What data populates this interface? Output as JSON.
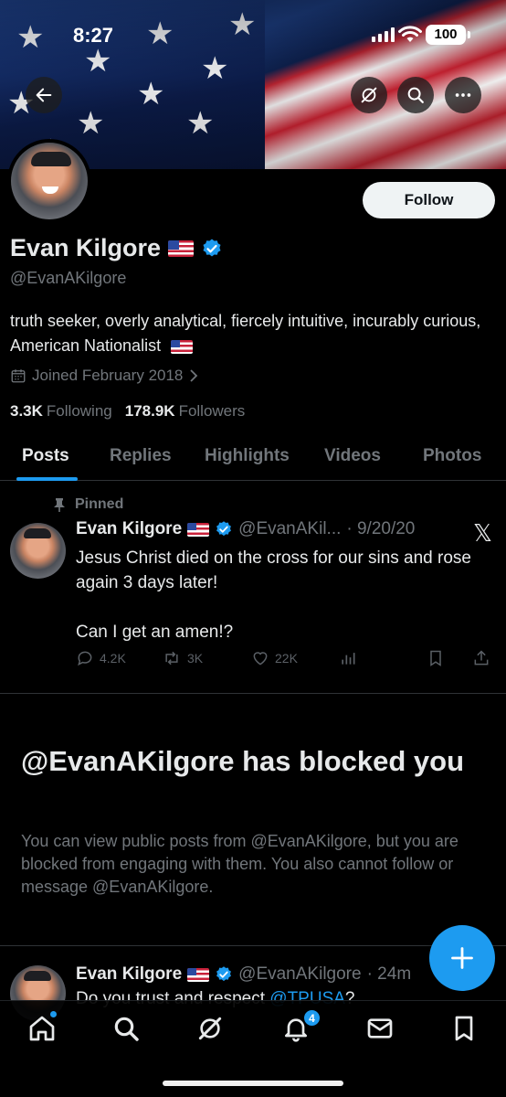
{
  "status_bar": {
    "time": "8:27",
    "battery": "100"
  },
  "profile": {
    "name": "Evan Kilgore",
    "handle": "@EvanAKilgore",
    "bio": "truth seeker, overly analytical, fiercely intuitive, incurably curious, American Nationalist",
    "joined": "Joined February 2018",
    "following_count": "3.3K",
    "following_label": "Following",
    "followers_count": "178.9K",
    "followers_label": "Followers",
    "follow_button": "Follow"
  },
  "tabs": [
    {
      "label": "Posts",
      "active": true
    },
    {
      "label": "Replies"
    },
    {
      "label": "Highlights"
    },
    {
      "label": "Videos"
    },
    {
      "label": "Photos"
    }
  ],
  "pinned_post": {
    "pinned_label": "Pinned",
    "name": "Evan Kilgore",
    "handle_trunc": "@EvanAKil...",
    "date": "· 9/20/20",
    "text_line1": "Jesus Christ died on the cross for our sins and rose again 3 days later!",
    "text_line2": "Can I get an amen!?",
    "replies": "4.2K",
    "reposts": "3K",
    "likes": "22K"
  },
  "blocked": {
    "title": "@EvanAKilgore has blocked you",
    "body": "You can view public posts from @EvanAKilgore, but you are blocked from engaging with them. You also cannot follow or message @EvanAKilgore."
  },
  "second_post": {
    "name": "Evan Kilgore",
    "handle": "@EvanAKilgore",
    "time": "· 24m",
    "text_prefix": "Do you trust and respect ",
    "mention": "@TPUSA",
    "text_suffix": "?"
  },
  "nav": {
    "notifications_badge": "4"
  },
  "colors": {
    "accent": "#1d9bf0",
    "background": "#000000",
    "muted": "#71767b"
  }
}
